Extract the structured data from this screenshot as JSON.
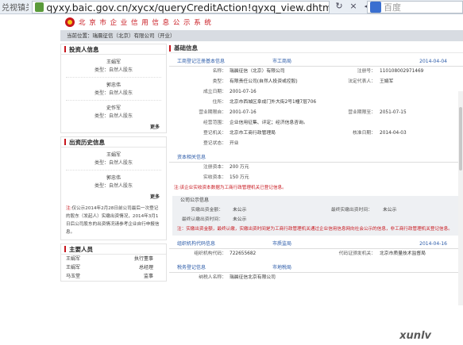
{
  "browser": {
    "compat_label": "兑视镇关",
    "url": "qyxy.baic.gov.cn/xycx/queryCreditAction!qyxq_view.dhtml?r",
    "search_placeholder": "百度"
  },
  "site": {
    "title": "北 京 市 企 业 信 用 信 息 公 示 系 统",
    "breadcrumb": "当前位置：瑞晨征信（北京）有限公司（开业）"
  },
  "investors": {
    "title": "投资人信息",
    "items": [
      {
        "name": "王娟军",
        "type": "类型：自然人股东"
      },
      {
        "name": "郭忠伟",
        "type": "类型：自然人股东"
      },
      {
        "name": "史作军",
        "type": "类型：自然人股东"
      }
    ],
    "more": "更多"
  },
  "history": {
    "title": "出资历史信息",
    "items": [
      {
        "name": "王娟军",
        "type": "类型：自然人股东"
      },
      {
        "name": "郭忠伟",
        "type": "类型：自然人股东"
      }
    ],
    "more": "更多",
    "note_prefix": "注:",
    "note": "仅公示2014年2月28日前公司最后一次登记的股东（发起人）实缴出资情况，2014年3月1日后公司股东的出资情况请参考企业自行申报信息。"
  },
  "managers": {
    "title": "主要人员",
    "rows": [
      {
        "name": "王娟军",
        "role": "执行董事"
      },
      {
        "name": "王娟军",
        "role": "总经理"
      },
      {
        "name": "马玉堂",
        "role": "监事"
      }
    ]
  },
  "basic": {
    "title": "基础信息",
    "record": {
      "label": "工商登记注册基本信息",
      "org": "市工商局",
      "date": "2014-04-04"
    },
    "fields": {
      "name_l": "名称：",
      "name_v": "瑞晨征信（北京）有限公司",
      "regno_l": "注册号：",
      "regno_v": "110108002971469",
      "type_l": "类型：",
      "type_v": "有限责任公司(自然人投资或控股)",
      "rep_l": "法定代表人：",
      "rep_v": "王娟军",
      "est_l": "成立日期：",
      "est_v": "2001-07-16",
      "addr_l": "住所：",
      "addr_v": "北京市西城区阜成门外大街2号1幢7层706",
      "term_start_l": "营业期限自：",
      "term_start_v": "2001-07-16",
      "term_end_l": "营业期限至：",
      "term_end_v": "2051-07-15",
      "scope_l": "经营范围：",
      "scope_v": "企业信用征集、评定；经济信息咨询。",
      "authority_l": "登记机关：",
      "authority_v": "北京市工商行政管理局",
      "approve_l": "核准日期：",
      "approve_v": "2014-04-03",
      "status_l": "登记状态：",
      "status_v": "开业"
    }
  },
  "capital": {
    "title": "资本相关信息",
    "reg_l": "注册资本：",
    "reg_v": "200 万元",
    "paid_l": "实收资本：",
    "paid_v": "150 万元",
    "note": "注:该企业实收资本数据为工商行政管理机关已登记信息。"
  },
  "annual": {
    "title": "公司公示信息",
    "paid_info_l": "实缴出资金额：",
    "paid_info_v": "未公示",
    "last_paid_l": "最终实缴出资时间：",
    "last_paid_v": "未公示",
    "sub_l": "最终认缴出资时间：",
    "sub_v": "未公示",
    "note": "注：实缴出资金额，最终认缴，实缴出资时间是为工商行政管理机关通过企业信用信息网向社会公示的信息，非工商行政管理机关登记信息。"
  },
  "org_code": {
    "record": {
      "label": "组织机构代码信息",
      "org": "市质监局",
      "date": "2014-04-16"
    },
    "code_l": "组织机构代码：",
    "code_v": "722655682",
    "issuer_l": "代码证颁发机关：",
    "issuer_v": "北京市质量技术监督局"
  },
  "tax": {
    "record": {
      "label": "税务登记信息",
      "org": "市地税局"
    },
    "taxpayer_l": "纳税人名称：",
    "taxpayer_v": "瑞晨征信北京有限公司"
  },
  "watermark": "xunlv"
}
